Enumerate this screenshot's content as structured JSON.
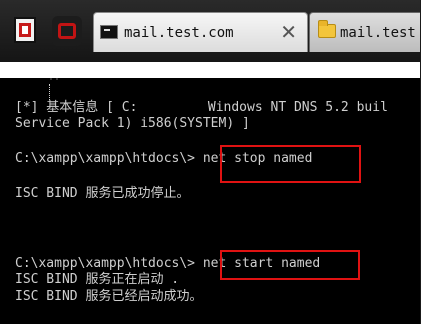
{
  "tabs": [
    {
      "label": "mail.test.com",
      "icon": "command-prompt-icon",
      "active": true
    },
    {
      "label": "mail.test",
      "icon": "folder-icon",
      "active": false
    }
  ],
  "terminal": {
    "lines": [
      "[*] 基本信息 [ C:         Windows NT DNS 5.2 buil",
      "Service Pack 1) i586(SYSTEM) ]",
      "C:\\xampp\\xampp\\htdocs\\> net stop named",
      "ISC BIND 服务已成功停止。",
      "C:\\xampp\\xampp\\htdocs\\> net start named",
      "ISC BIND 服务正在启动 .",
      "ISC BIND 服务已经启动成功。"
    ]
  },
  "colors": {
    "tabbar": "#1e1e1e",
    "terminal_bg": "#000000",
    "terminal_text": "#cfcfcf",
    "highlight": "#e01212"
  }
}
